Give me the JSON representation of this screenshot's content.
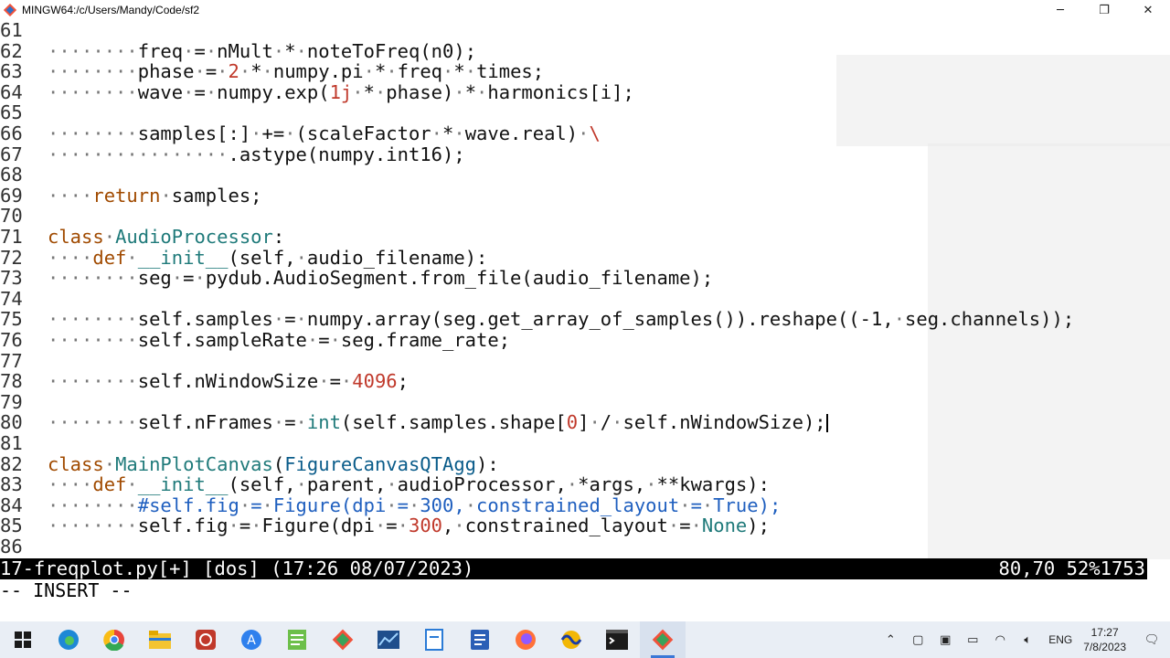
{
  "window": {
    "title": "MINGW64:/c/Users/Mandy/Code/sf2",
    "minimize_icon": "minimize-icon",
    "maximize_icon": "restore-icon",
    "close_icon": "close-icon"
  },
  "editor": {
    "lines": [
      {
        "num": "61",
        "text": ""
      },
      {
        "num": "62",
        "text": "········freq·=·nMult·*·noteToFreq(n0);"
      },
      {
        "num": "63",
        "text": "········phase·=·2·*·numpy.pi·*·freq·*·times;"
      },
      {
        "num": "64",
        "text": "········wave·=·numpy.exp(1j·*·phase)·*·harmonics[i];"
      },
      {
        "num": "65",
        "text": ""
      },
      {
        "num": "66",
        "text": "········samples[:]·+=·(scaleFactor·*·wave.real)·\\"
      },
      {
        "num": "67",
        "text": "················.astype(numpy.int16);"
      },
      {
        "num": "68",
        "text": ""
      },
      {
        "num": "69",
        "text": "····return·samples;"
      },
      {
        "num": "70",
        "text": ""
      },
      {
        "num": "71",
        "text": "class·AudioProcessor:"
      },
      {
        "num": "72",
        "text": "····def·__init__(self,·audio_filename):"
      },
      {
        "num": "73",
        "text": "········seg·=·pydub.AudioSegment.from_file(audio_filename);"
      },
      {
        "num": "74",
        "text": ""
      },
      {
        "num": "75",
        "text": "········self.samples·=·numpy.array(seg.get_array_of_samples()).reshape((-1,·seg.channels));"
      },
      {
        "num": "76",
        "text": "········self.sampleRate·=·seg.frame_rate;"
      },
      {
        "num": "77",
        "text": ""
      },
      {
        "num": "78",
        "text": "········self.nWindowSize·=·4096;"
      },
      {
        "num": "79",
        "text": ""
      },
      {
        "num": "80",
        "text": "········self.nFrames·=·int(self.samples.shape[0]·/·self.nWindowSize);"
      },
      {
        "num": "81",
        "text": ""
      },
      {
        "num": "82",
        "text": "class·MainPlotCanvas(FigureCanvasQTAgg):"
      },
      {
        "num": "83",
        "text": "····def·__init__(self,·parent,·audioProcessor,·*args,·**kwargs):"
      },
      {
        "num": "84",
        "text": "········#self.fig·=·Figure(dpi·=·300,·constrained_layout·=·True);"
      },
      {
        "num": "85",
        "text": "········self.fig·=·Figure(dpi·=·300,·constrained_layout·=·None);"
      },
      {
        "num": "86",
        "text": ""
      }
    ]
  },
  "statusline": {
    "left": "17-freqplot.py[+] [dos] (17:26 08/07/2023)",
    "right": "80,70 52%1753"
  },
  "mode": "-- INSERT --",
  "taskbar": {
    "apps": [
      {
        "icon": "windows-start-icon",
        "active": false
      },
      {
        "icon": "edge-icon",
        "active": false
      },
      {
        "icon": "chrome-icon",
        "active": false
      },
      {
        "icon": "file-explorer-icon",
        "active": false
      },
      {
        "icon": "tool-icon",
        "active": false
      },
      {
        "icon": "app-store-icon",
        "active": false
      },
      {
        "icon": "notepad-icon",
        "active": false
      },
      {
        "icon": "git-icon",
        "active": false
      },
      {
        "icon": "chart-app-icon",
        "active": false
      },
      {
        "icon": "document-icon",
        "active": false
      },
      {
        "icon": "word-icon",
        "active": false
      },
      {
        "icon": "firefox-icon",
        "active": false
      },
      {
        "icon": "audio-app-icon",
        "active": false
      },
      {
        "icon": "terminal-icon",
        "active": false
      },
      {
        "icon": "git-bash-icon",
        "active": true
      }
    ],
    "tray": {
      "language": "ENG",
      "time": "17:27",
      "date": "7/8/2023"
    }
  },
  "colors": {
    "keyword": "#a04a00",
    "classname": "#1f7a7a",
    "number": "#c0392b",
    "comment": "#1f5fbf",
    "statusbar_bg": "#000000"
  }
}
